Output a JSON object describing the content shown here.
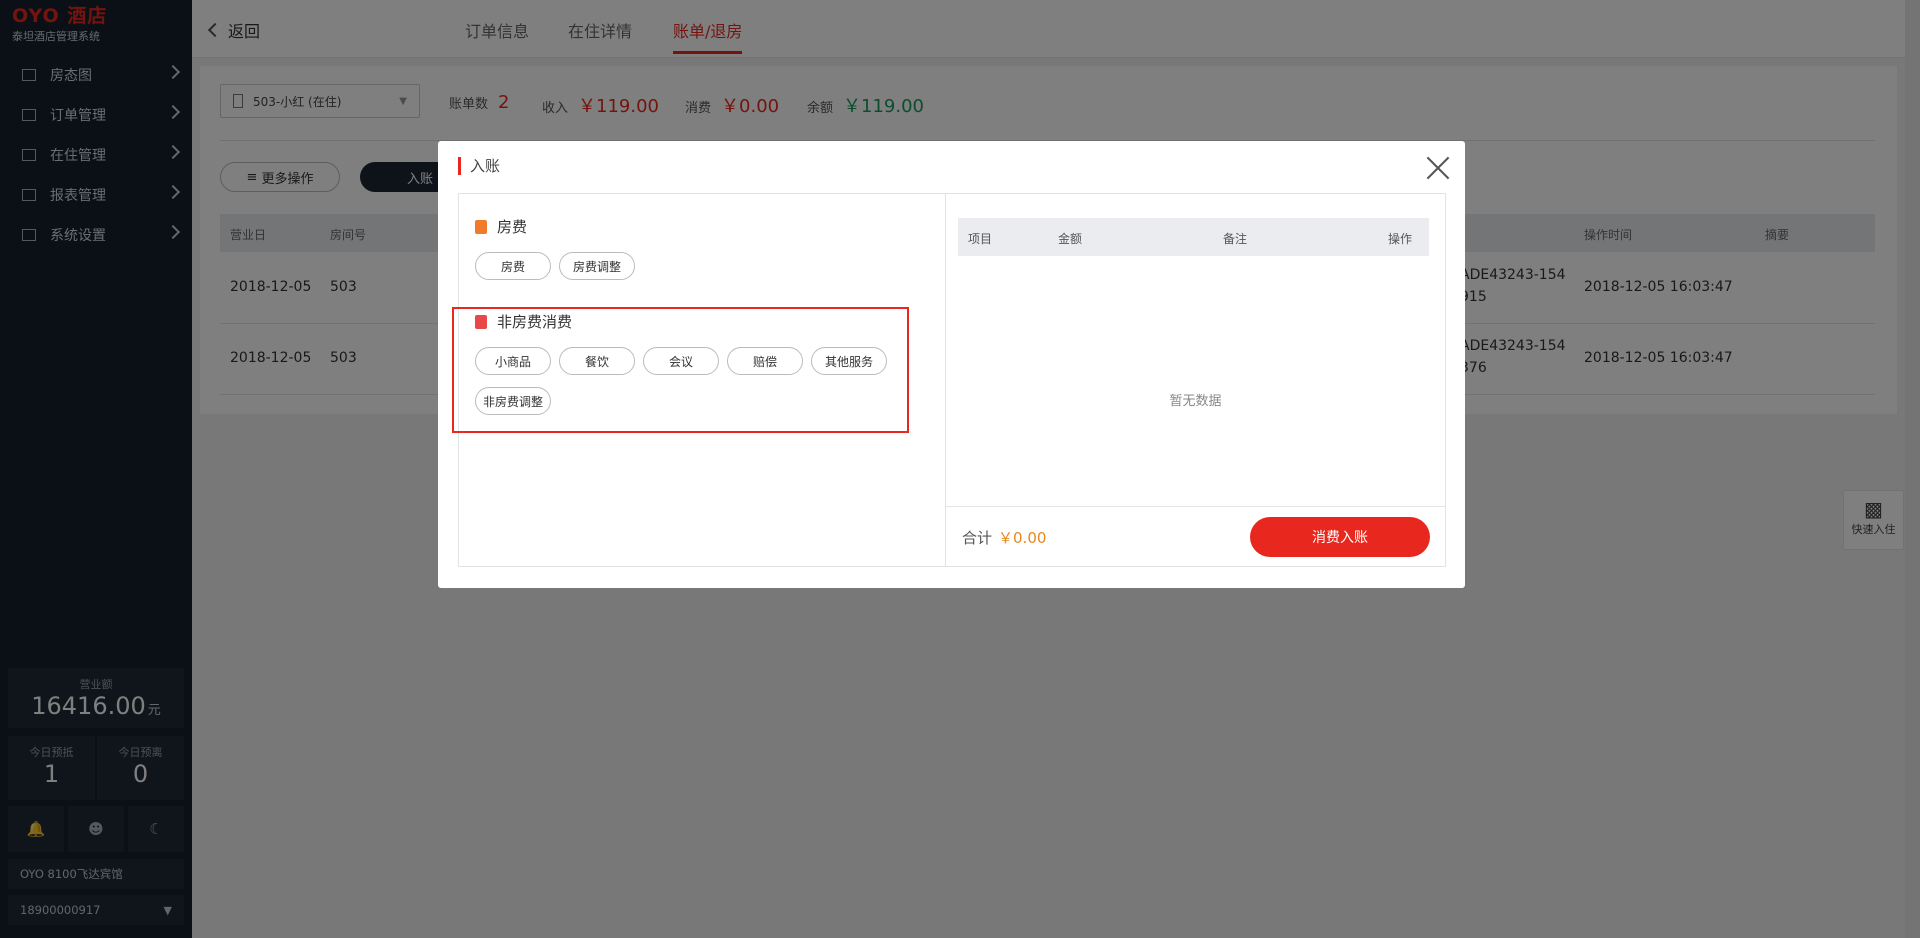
{
  "app": {
    "brand": "OYO 酒店",
    "subtitle": "泰坦酒店管理系统"
  },
  "sidebar": {
    "items": [
      {
        "label": "房态图",
        "icon": "grid-icon"
      },
      {
        "label": "订单管理",
        "icon": "list-icon"
      },
      {
        "label": "在住管理",
        "icon": "bed-icon"
      },
      {
        "label": "报表管理",
        "icon": "chart-icon"
      },
      {
        "label": "系统设置",
        "icon": "settings-icon"
      }
    ],
    "revenue": {
      "label": "营业额",
      "value": "16416.00",
      "unit": "元"
    },
    "today_deposit": {
      "label": "今日预抵",
      "value": "1"
    },
    "today_leave": {
      "label": "今日预离",
      "value": "0"
    },
    "icons": [
      "bell-icon",
      "user-icon",
      "moon-icon"
    ],
    "hotel": "OYO 8100飞达宾馆",
    "phone": "18900000917"
  },
  "header": {
    "back": "返回",
    "tabs": [
      "订单信息",
      "在住详情",
      "账单/退房"
    ],
    "active_tab": "账单/退房"
  },
  "bill": {
    "room": "503-小红 (在住)",
    "count_label": "账单数",
    "count": "2",
    "income_label": "收入",
    "income": "￥119.00",
    "expense_label": "消费",
    "expense": "￥0.00",
    "balance_label": "余额",
    "balance": "￥119.00",
    "more_ops": "更多操作",
    "post_btn": "入账",
    "columns": [
      "营业日",
      "房间号",
      "操作时间",
      "摘要"
    ],
    "rows": [
      {
        "date": "2018-12-05",
        "room": "503",
        "ref1": "ADE43243-154",
        "ref2": "915",
        "time": "2018-12-05 16:03:47"
      },
      {
        "date": "2018-12-05",
        "room": "503",
        "ref1": "ADE43243-154",
        "ref2": "376",
        "time": "2018-12-05 16:03:47"
      }
    ]
  },
  "quick_checkin": "快速入住",
  "modal": {
    "title": "入账",
    "room_fee": {
      "title": "房费",
      "options": [
        "房费",
        "房费调整"
      ]
    },
    "non_room": {
      "title": "非房费消费",
      "options": [
        "小商品",
        "餐饮",
        "会议",
        "赔偿",
        "其他服务",
        "非房费调整"
      ]
    },
    "table_columns": [
      "项目",
      "金额",
      "备注",
      "操作"
    ],
    "empty": "暂无数据",
    "total_label": "合计",
    "total_value": "￥0.00",
    "submit": "消费入账"
  },
  "colors": {
    "accent": "#e8281e",
    "sidebar": "#17202c",
    "balance": "#1a9a5c"
  }
}
